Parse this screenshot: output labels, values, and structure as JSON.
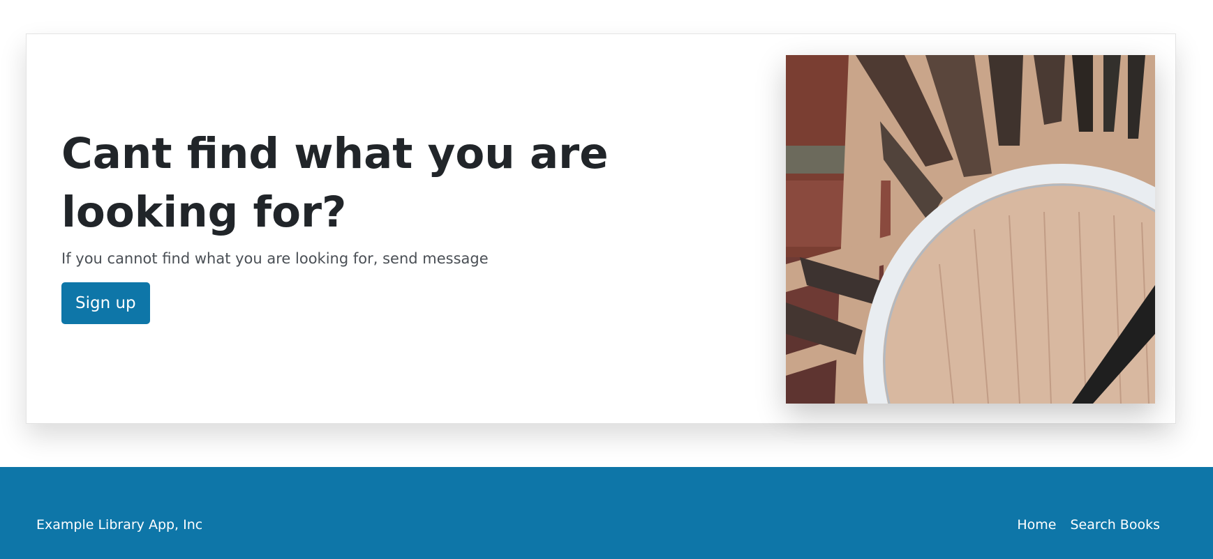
{
  "hero": {
    "title": "Cant find what you are looking for?",
    "subtitle": "If you cannot find what you are looking for, send message",
    "signup_label": "Sign up"
  },
  "footer": {
    "company": "Example Library App, Inc",
    "links": [
      {
        "label": "Home"
      },
      {
        "label": "Search Books"
      }
    ]
  },
  "colors": {
    "accent": "#0e76a8",
    "heading": "#212529",
    "subtitle": "#4a4f55"
  }
}
